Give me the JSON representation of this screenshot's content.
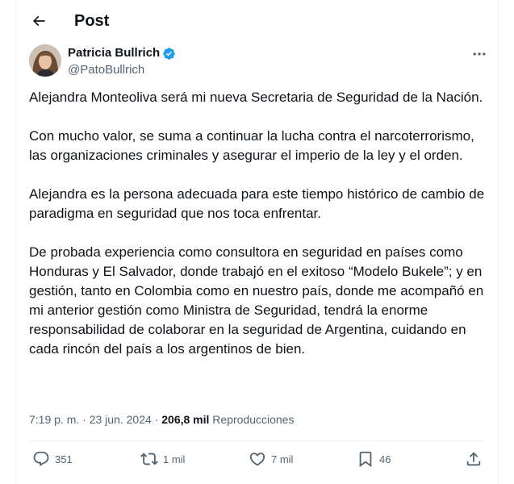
{
  "header": {
    "title": "Post",
    "back_icon": "arrow-left-icon"
  },
  "author": {
    "name": "Patricia Bullrich",
    "handle": "@PatoBullrich",
    "verified": true,
    "verified_color": "#1d9bf0"
  },
  "tweet": {
    "paragraphs": [
      "Alejandra Monteoliva será mi nueva Secretaria de Seguridad de la Nación.",
      "Con mucho valor, se suma a continuar la lucha contra el narcoterrorismo, las organizaciones criminales y asegurar el imperio de la ley y el orden.",
      "Alejandra es la persona adecuada para este tiempo histórico de cambio de paradigma en seguridad que nos toca enfrentar.",
      "De probada experiencia como consultora en seguridad en países como Honduras y El Salvador, donde trabajó en el exitoso “Modelo Bukele”; y en gestión, tanto en Colombia como en nuestro país, donde me acompañó en mi anterior gestión como Ministra de Seguridad, tendrá la enorme responsabilidad de colaborar en la seguridad de Argentina, cuidando en cada rincón del país a los argentinos de bien."
    ]
  },
  "meta": {
    "time": "7:19 p. m.",
    "separator": "·",
    "date": "23 jun. 2024",
    "views_count": "206,8 mil",
    "views_label": "Reproducciones"
  },
  "actions": {
    "replies": "351",
    "reposts": "1 mil",
    "likes": "7 mil",
    "bookmarks": "46"
  },
  "colors": {
    "text": "#0f1419",
    "muted": "#536471",
    "border": "#eff3f4"
  }
}
